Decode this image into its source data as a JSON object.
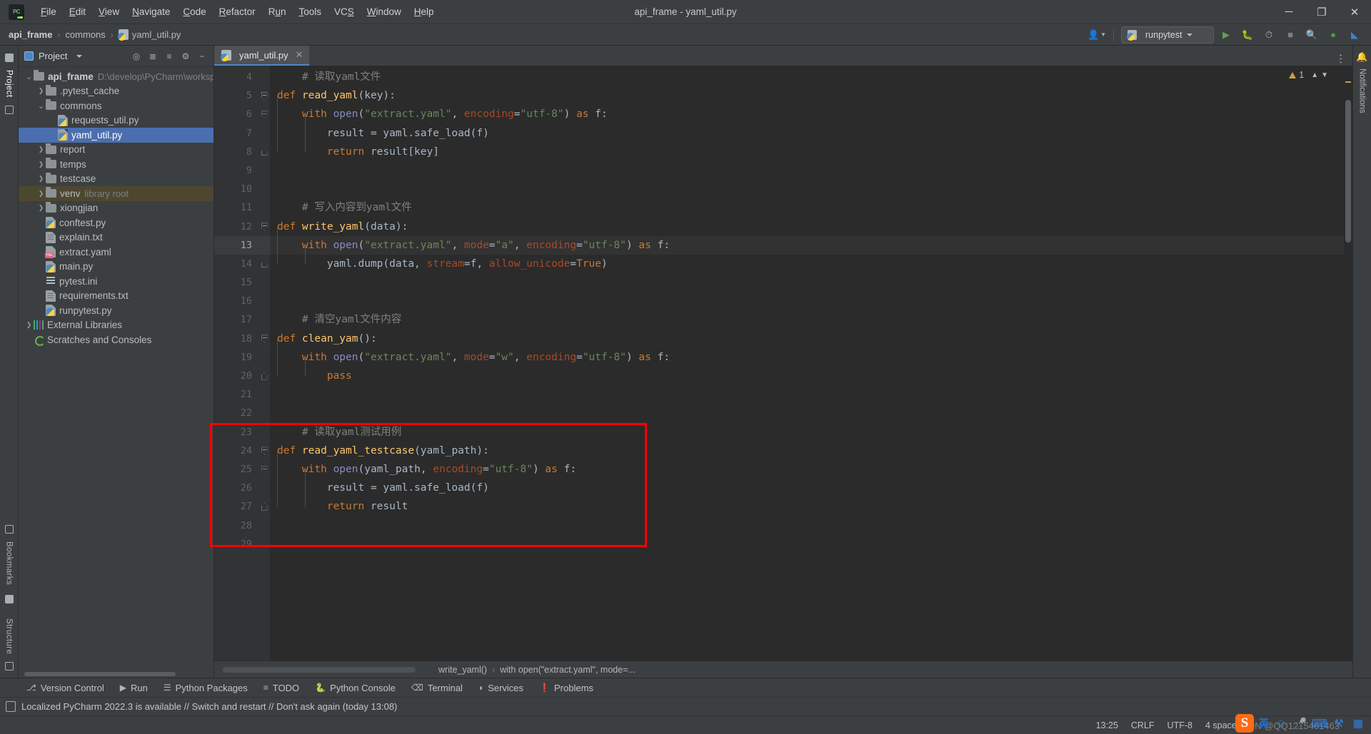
{
  "window": {
    "title": "api_frame - yaml_util.py",
    "minimize": "─",
    "maximize": "❐",
    "close": "✕"
  },
  "menu": {
    "items": [
      "File",
      "Edit",
      "View",
      "Navigate",
      "Code",
      "Refactor",
      "Run",
      "Tools",
      "VCS",
      "Window",
      "Help"
    ]
  },
  "breadcrumb": {
    "project": "api_frame",
    "folder": "commons",
    "file": "yaml_util.py",
    "separator": "›"
  },
  "toolbar": {
    "run_config": "runpytest",
    "account_icon": "account-icon",
    "run_icon": "run-icon",
    "debug_icon": "debug-icon",
    "coverage_icon": "coverage-icon",
    "stop_icon": "stop-icon",
    "search_icon": "search-icon",
    "updates_icon": "updates-icon",
    "ide_icon": "ide-icon"
  },
  "left_rail": {
    "project_label": "Project",
    "bookmarks_label": "Bookmarks",
    "structure_label": "Structure"
  },
  "right_rail": {
    "notifications_label": "Notifications"
  },
  "project_panel": {
    "title": "Project",
    "tree": [
      {
        "label": "api_frame",
        "hint": "D:\\develop\\PyCharm\\worksp",
        "depth": 0,
        "arrow": "expanded",
        "icon": "folder",
        "bold": true,
        "state": "normal"
      },
      {
        "label": ".pytest_cache",
        "hint": "",
        "depth": 1,
        "arrow": "collapsed",
        "icon": "folder",
        "bold": false,
        "state": "normal"
      },
      {
        "label": "commons",
        "hint": "",
        "depth": 1,
        "arrow": "expanded",
        "icon": "folder",
        "bold": false,
        "state": "normal"
      },
      {
        "label": "requests_util.py",
        "hint": "",
        "depth": 2,
        "arrow": "none",
        "icon": "python",
        "bold": false,
        "state": "normal"
      },
      {
        "label": "yaml_util.py",
        "hint": "",
        "depth": 2,
        "arrow": "none",
        "icon": "python",
        "bold": false,
        "state": "selected"
      },
      {
        "label": "report",
        "hint": "",
        "depth": 1,
        "arrow": "collapsed",
        "icon": "folder",
        "bold": false,
        "state": "normal"
      },
      {
        "label": "temps",
        "hint": "",
        "depth": 1,
        "arrow": "collapsed",
        "icon": "folder",
        "bold": false,
        "state": "normal"
      },
      {
        "label": "testcase",
        "hint": "",
        "depth": 1,
        "arrow": "collapsed",
        "icon": "folder",
        "bold": false,
        "state": "normal"
      },
      {
        "label": "venv",
        "hint": "library root",
        "depth": 1,
        "arrow": "collapsed",
        "icon": "folder",
        "bold": false,
        "state": "library"
      },
      {
        "label": "xiongjian",
        "hint": "",
        "depth": 1,
        "arrow": "collapsed",
        "icon": "folder",
        "bold": false,
        "state": "normal"
      },
      {
        "label": "conftest.py",
        "hint": "",
        "depth": 1,
        "arrow": "none",
        "icon": "python",
        "bold": false,
        "state": "normal"
      },
      {
        "label": "explain.txt",
        "hint": "",
        "depth": 1,
        "arrow": "none",
        "icon": "text",
        "bold": false,
        "state": "normal"
      },
      {
        "label": "extract.yaml",
        "hint": "",
        "depth": 1,
        "arrow": "none",
        "icon": "yaml",
        "bold": false,
        "state": "normal"
      },
      {
        "label": "main.py",
        "hint": "",
        "depth": 1,
        "arrow": "none",
        "icon": "python",
        "bold": false,
        "state": "normal"
      },
      {
        "label": "pytest.ini",
        "hint": "",
        "depth": 1,
        "arrow": "none",
        "icon": "ini",
        "bold": false,
        "state": "normal"
      },
      {
        "label": "requirements.txt",
        "hint": "",
        "depth": 1,
        "arrow": "none",
        "icon": "text",
        "bold": false,
        "state": "normal"
      },
      {
        "label": "runpytest.py",
        "hint": "",
        "depth": 1,
        "arrow": "none",
        "icon": "python",
        "bold": false,
        "state": "normal"
      },
      {
        "label": "External Libraries",
        "hint": "",
        "depth": 0,
        "arrow": "collapsed",
        "icon": "library",
        "bold": false,
        "state": "normal"
      },
      {
        "label": "Scratches and Consoles",
        "hint": "",
        "depth": 0,
        "arrow": "none",
        "icon": "scratch",
        "bold": false,
        "state": "normal"
      }
    ]
  },
  "editor": {
    "tab_label": "yaml_util.py",
    "tab_close": "✕",
    "warning_count": "1",
    "first_line_number": 4,
    "lines": [
      {
        "n": 4,
        "hl": false,
        "fold": "",
        "tokens": [
          {
            "t": "    # 读取yaml文件",
            "c": "cm"
          }
        ]
      },
      {
        "n": 5,
        "hl": false,
        "fold": "minus",
        "tokens": [
          {
            "t": "def ",
            "c": "k"
          },
          {
            "t": "read_yaml",
            "c": "fn"
          },
          {
            "t": "(key):",
            "c": "p"
          }
        ]
      },
      {
        "n": 6,
        "hl": false,
        "fold": "minus2",
        "tokens": [
          {
            "t": "    ",
            "c": "p"
          },
          {
            "t": "with ",
            "c": "k"
          },
          {
            "t": "open",
            "c": "bi"
          },
          {
            "t": "(",
            "c": "p"
          },
          {
            "t": "\"extract.yaml\"",
            "c": "s"
          },
          {
            "t": ", ",
            "c": "p"
          },
          {
            "t": "encoding",
            "c": "kw2"
          },
          {
            "t": "=",
            "c": "p"
          },
          {
            "t": "\"utf-8\"",
            "c": "s"
          },
          {
            "t": ") ",
            "c": "p"
          },
          {
            "t": "as ",
            "c": "k"
          },
          {
            "t": "f:",
            "c": "p"
          }
        ]
      },
      {
        "n": 7,
        "hl": false,
        "fold": "",
        "tokens": [
          {
            "t": "        result = yaml.safe_load(f)",
            "c": "p"
          }
        ]
      },
      {
        "n": 8,
        "hl": false,
        "fold": "bot",
        "tokens": [
          {
            "t": "        ",
            "c": "p"
          },
          {
            "t": "return ",
            "c": "k"
          },
          {
            "t": "result[key]",
            "c": "p"
          }
        ]
      },
      {
        "n": 9,
        "hl": false,
        "fold": "",
        "tokens": []
      },
      {
        "n": 10,
        "hl": false,
        "fold": "",
        "tokens": []
      },
      {
        "n": 11,
        "hl": false,
        "fold": "",
        "tokens": [
          {
            "t": "    # 写入内容到yaml文件",
            "c": "cm"
          }
        ]
      },
      {
        "n": 12,
        "hl": false,
        "fold": "minus",
        "tokens": [
          {
            "t": "def ",
            "c": "k"
          },
          {
            "t": "write_yaml",
            "c": "fn"
          },
          {
            "t": "(data):",
            "c": "p"
          }
        ]
      },
      {
        "n": 13,
        "hl": true,
        "fold": "",
        "tokens": [
          {
            "t": "    ",
            "c": "p"
          },
          {
            "t": "with ",
            "c": "k"
          },
          {
            "t": "open",
            "c": "bi"
          },
          {
            "t": "(",
            "c": "p"
          },
          {
            "t": "\"extract.yaml\"",
            "c": "s"
          },
          {
            "t": ", ",
            "c": "p"
          },
          {
            "t": "mode",
            "c": "kw2"
          },
          {
            "t": "=",
            "c": "p"
          },
          {
            "t": "\"a\"",
            "c": "s"
          },
          {
            "t": ", ",
            "c": "p"
          },
          {
            "t": "encoding",
            "c": "kw2"
          },
          {
            "t": "=",
            "c": "p"
          },
          {
            "t": "\"utf-8\"",
            "c": "s"
          },
          {
            "t": ") ",
            "c": "p"
          },
          {
            "t": "as ",
            "c": "k"
          },
          {
            "t": "f:",
            "c": "p"
          }
        ]
      },
      {
        "n": 14,
        "hl": false,
        "fold": "bot",
        "tokens": [
          {
            "t": "        yaml.dump(data, ",
            "c": "p"
          },
          {
            "t": "stream",
            "c": "kw2"
          },
          {
            "t": "=f, ",
            "c": "p"
          },
          {
            "t": "allow_unicode",
            "c": "kw2"
          },
          {
            "t": "=",
            "c": "p"
          },
          {
            "t": "True",
            "c": "k"
          },
          {
            "t": ")",
            "c": "p"
          }
        ]
      },
      {
        "n": 15,
        "hl": false,
        "fold": "",
        "tokens": []
      },
      {
        "n": 16,
        "hl": false,
        "fold": "",
        "tokens": []
      },
      {
        "n": 17,
        "hl": false,
        "fold": "",
        "tokens": [
          {
            "t": "    # 清空yaml文件内容",
            "c": "cm"
          }
        ]
      },
      {
        "n": 18,
        "hl": false,
        "fold": "minus",
        "tokens": [
          {
            "t": "def ",
            "c": "k"
          },
          {
            "t": "clean_yam",
            "c": "fn"
          },
          {
            "t": "():",
            "c": "p"
          }
        ]
      },
      {
        "n": 19,
        "hl": false,
        "fold": "",
        "tokens": [
          {
            "t": "    ",
            "c": "p"
          },
          {
            "t": "with ",
            "c": "k"
          },
          {
            "t": "open",
            "c": "bi"
          },
          {
            "t": "(",
            "c": "p"
          },
          {
            "t": "\"extract.yaml\"",
            "c": "s"
          },
          {
            "t": ", ",
            "c": "p"
          },
          {
            "t": "mode",
            "c": "kw2"
          },
          {
            "t": "=",
            "c": "p"
          },
          {
            "t": "\"w\"",
            "c": "s"
          },
          {
            "t": ", ",
            "c": "p"
          },
          {
            "t": "encoding",
            "c": "kw2"
          },
          {
            "t": "=",
            "c": "p"
          },
          {
            "t": "\"utf-8\"",
            "c": "s"
          },
          {
            "t": ") ",
            "c": "p"
          },
          {
            "t": "as ",
            "c": "k"
          },
          {
            "t": "f:",
            "c": "p"
          }
        ]
      },
      {
        "n": 20,
        "hl": false,
        "fold": "bot",
        "tokens": [
          {
            "t": "        ",
            "c": "p"
          },
          {
            "t": "pass",
            "c": "k"
          }
        ]
      },
      {
        "n": 21,
        "hl": false,
        "fold": "",
        "tokens": []
      },
      {
        "n": 22,
        "hl": false,
        "fold": "",
        "tokens": []
      },
      {
        "n": 23,
        "hl": false,
        "fold": "",
        "tokens": [
          {
            "t": "    # 读取yaml测试用例",
            "c": "cm"
          }
        ]
      },
      {
        "n": 24,
        "hl": false,
        "fold": "minus",
        "tokens": [
          {
            "t": "def ",
            "c": "k"
          },
          {
            "t": "read_yaml_testcase",
            "c": "fn"
          },
          {
            "t": "(yaml_path):",
            "c": "p"
          }
        ]
      },
      {
        "n": 25,
        "hl": false,
        "fold": "minus2",
        "tokens": [
          {
            "t": "    ",
            "c": "p"
          },
          {
            "t": "with ",
            "c": "k"
          },
          {
            "t": "open",
            "c": "bi"
          },
          {
            "t": "(yaml_path, ",
            "c": "p"
          },
          {
            "t": "encoding",
            "c": "kw2"
          },
          {
            "t": "=",
            "c": "p"
          },
          {
            "t": "\"utf-8\"",
            "c": "s"
          },
          {
            "t": ") ",
            "c": "p"
          },
          {
            "t": "as ",
            "c": "k"
          },
          {
            "t": "f:",
            "c": "p"
          }
        ]
      },
      {
        "n": 26,
        "hl": false,
        "fold": "",
        "tokens": [
          {
            "t": "        result = yaml.safe_load(f)",
            "c": "p"
          }
        ]
      },
      {
        "n": 27,
        "hl": false,
        "fold": "bot",
        "tokens": [
          {
            "t": "        ",
            "c": "p"
          },
          {
            "t": "return ",
            "c": "k"
          },
          {
            "t": "result",
            "c": "p"
          }
        ]
      },
      {
        "n": 28,
        "hl": false,
        "fold": "",
        "tokens": []
      },
      {
        "n": 29,
        "hl": false,
        "fold": "",
        "tokens": []
      }
    ]
  },
  "editor_breadcrumb": {
    "func": "write_yaml()",
    "separator": "›",
    "stmt": "with open(\"extract.yaml\", mode=..."
  },
  "bottom_tools": [
    {
      "label": "Version Control",
      "icon": "branch-icon"
    },
    {
      "label": "Run",
      "icon": "play-icon"
    },
    {
      "label": "Python Packages",
      "icon": "packages-icon"
    },
    {
      "label": "TODO",
      "icon": "list-icon"
    },
    {
      "label": "Python Console",
      "icon": "python-icon"
    },
    {
      "label": "Terminal",
      "icon": "terminal-icon"
    },
    {
      "label": "Services",
      "icon": "services-icon"
    },
    {
      "label": "Problems",
      "icon": "problems-icon"
    }
  ],
  "notification": {
    "text": "Localized PyCharm 2022.3 is available // Switch and restart // Don't ask again (today 13:08)",
    "icon": "info-icon"
  },
  "status": {
    "cursor": "13:25",
    "line_sep": "CRLF",
    "encoding": "UTF-8",
    "indent": "4 spaces"
  },
  "ime": {
    "logo": "S",
    "mode": "英",
    "watermark": "CSDN @QQ1215461463"
  },
  "colors": {
    "accent": "#4b6eaf",
    "library_row": "#4e4730",
    "annotation_box": "#ff0000",
    "editor_bg": "#2b2b2b",
    "panel_bg": "#3c3f41",
    "keyword": "#cc7832",
    "string": "#6a8759",
    "function": "#ffc66d",
    "comment": "#808080",
    "named_arg": "#aa4926",
    "builtin": "#8888c6"
  }
}
